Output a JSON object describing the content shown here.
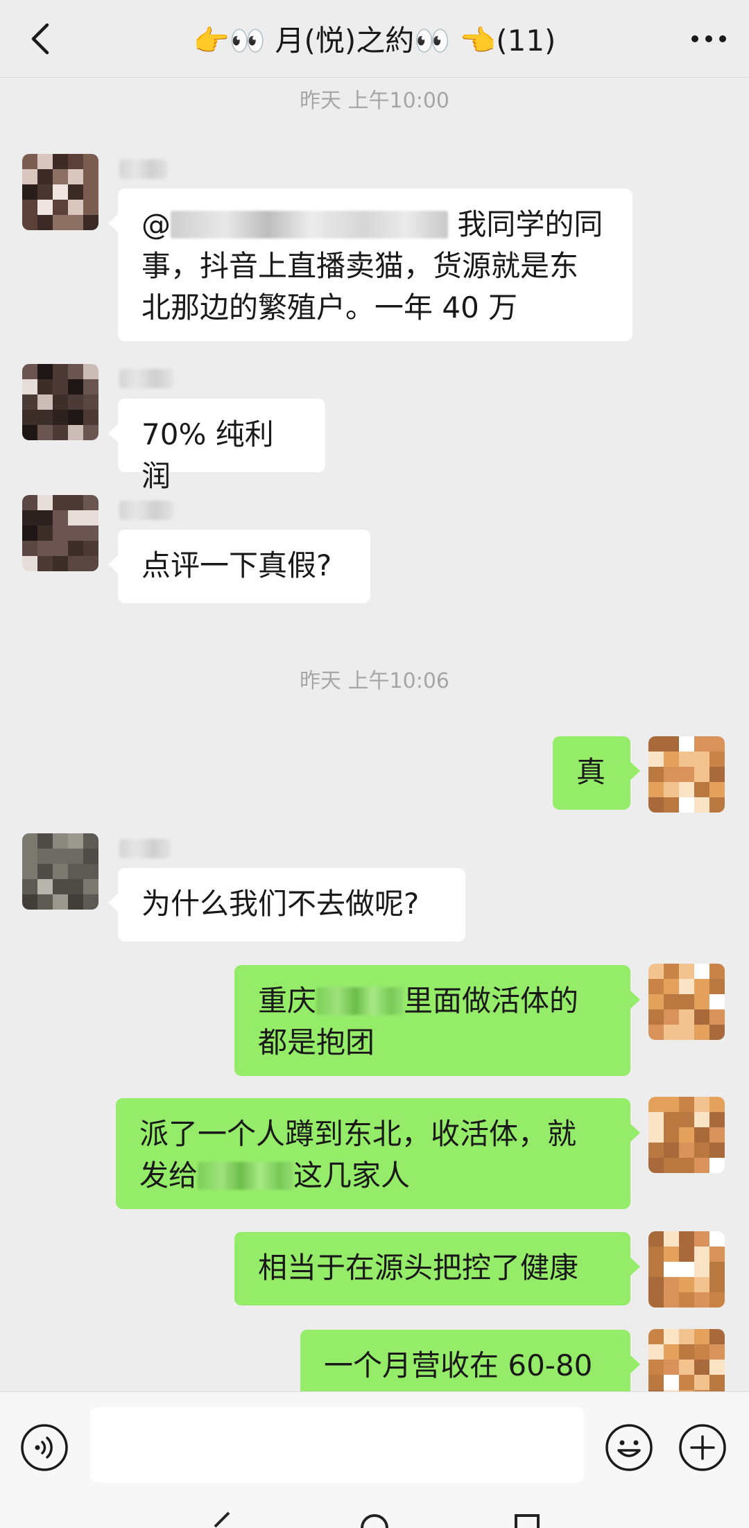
{
  "header": {
    "title": "👉👀  月(悦)之約👀 👈(11)"
  },
  "messages": {
    "ts1": "昨天 上午10:00",
    "m1_at": "@",
    "m1_line1_rest": " 我同学的同",
    "m1_line2": "事，抖音上直播卖猫，货源就是东",
    "m1_line3": "北那边的繁殖户。一年 40 万",
    "m2": "70% 纯利润",
    "m3": "点评一下真假?",
    "ts2": "昨天 上午10:06",
    "m4": "真",
    "m5": "为什么我们不去做呢?",
    "m6_line1_a": "重庆",
    "m6_line1_b": "里面做活体的",
    "m6_line2": "都是抱团",
    "m7_line1": "派了一个人蹲到东北，收活体，就",
    "m7_line2_a": "发给",
    "m7_line2_b": "这几家人",
    "m8": "相当于在源头把控了健康",
    "m9": "一个月营收在 60-80"
  },
  "input": {
    "placeholder": ""
  },
  "colors": {
    "background": "#ededed",
    "incoming_bubble": "#ffffff",
    "outgoing_bubble": "#95ec69",
    "timestamp": "#a6a6a6"
  },
  "icons": {
    "back": "chevron-left-icon",
    "more": "more-dots-icon",
    "voice": "voice-icon",
    "emoji": "emoji-icon",
    "plus": "plus-icon"
  }
}
